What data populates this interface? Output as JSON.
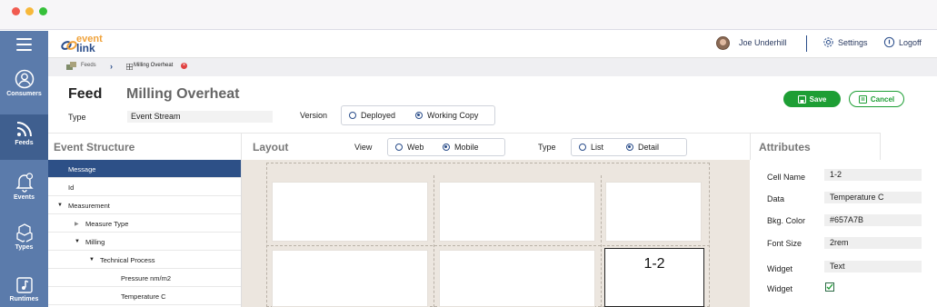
{
  "app": {
    "logo_line1": "event",
    "logo_line2": "link"
  },
  "colors": {
    "sidebar": "#5b7bab",
    "sidebar_active": "#3f5f8f",
    "primary": "#2a4d8a",
    "accent": "#f0a23a",
    "success": "#1d9e34",
    "tree_selected": "#2d5087"
  },
  "sidebar": {
    "menu_icon": "hamburger-icon",
    "items": [
      {
        "label": "Consumers",
        "icon": "user-icon",
        "active": false
      },
      {
        "label": "Feeds",
        "icon": "rss-icon",
        "active": true
      },
      {
        "label": "Events",
        "icon": "bell-icon",
        "active": false
      },
      {
        "label": "Types",
        "icon": "cubes-icon",
        "active": false
      },
      {
        "label": "Runtimes",
        "icon": "music-note-icon",
        "active": false
      }
    ]
  },
  "header": {
    "user_name": "Joe Underhill",
    "settings_label": "Settings",
    "logoff_label": "Logoff"
  },
  "breadcrumb": {
    "root": "Feeds",
    "current": "Milling Overheat"
  },
  "feed": {
    "title": "Feed",
    "name": "Milling Overheat",
    "type_label": "Type",
    "type_value": "Event Stream",
    "version_label": "Version",
    "version_options": [
      "Deployed",
      "Working Copy"
    ],
    "version_selected": "Working Copy"
  },
  "actions": {
    "save": "Save",
    "cancel": "Cancel"
  },
  "structure": {
    "title": "Event Structure",
    "rows": [
      {
        "label": "Message",
        "toggle": "",
        "selected": true
      },
      {
        "label": "Id",
        "toggle": "",
        "selected": false
      },
      {
        "label": "Measurement",
        "toggle": "▼",
        "selected": false
      },
      {
        "label": "Measure Type",
        "toggle": "▶",
        "selected": false
      },
      {
        "label": "Milling",
        "toggle": "▼",
        "selected": false
      },
      {
        "label": "Technical Process",
        "toggle": "▼",
        "selected": false
      },
      {
        "label": "Pressure nm/m2",
        "toggle": "",
        "selected": false
      },
      {
        "label": "Temperature C",
        "toggle": "",
        "selected": false
      }
    ]
  },
  "layout": {
    "title": "Layout",
    "view_label": "View",
    "view_options": [
      "Web",
      "Mobile"
    ],
    "view_selected": "Mobile",
    "type_label": "Type",
    "type_options": [
      "List",
      "Detail"
    ],
    "type_selected": "Detail",
    "selected_cell_text": "1-2"
  },
  "attributes": {
    "title": "Attributes",
    "fields": [
      {
        "label": "Cell Name",
        "value": "1-2"
      },
      {
        "label": "Data",
        "value": "Temperature C"
      },
      {
        "label": "Bkg. Color",
        "value": "#657A7B"
      },
      {
        "label": "Font Size",
        "value": "2rem"
      },
      {
        "label": "Widget",
        "value": "Text"
      }
    ],
    "widget_checkbox_label": "Widget",
    "widget_checked": true
  }
}
